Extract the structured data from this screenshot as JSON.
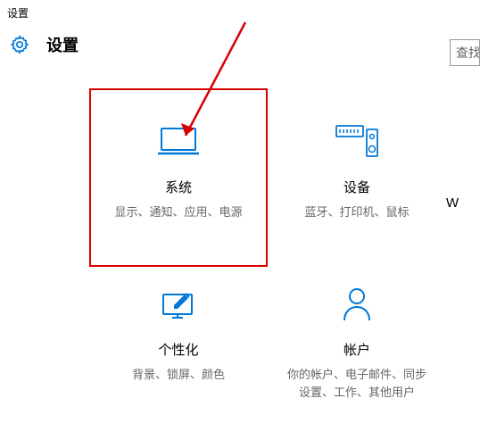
{
  "window": {
    "title": "设置"
  },
  "header": {
    "title": "设置"
  },
  "search": {
    "placeholder": "查找设"
  },
  "tiles": {
    "system": {
      "title": "系统",
      "desc": "显示、通知、应用、电源"
    },
    "devices": {
      "title": "设备",
      "desc": "蓝牙、打印机、鼠标"
    },
    "partial": {
      "title_first_char": "W"
    },
    "personalization": {
      "title": "个性化",
      "desc": "背景、锁屏、颜色"
    },
    "accounts": {
      "title": "帐户",
      "desc": "你的帐户、电子邮件、同步设置、工作、其他用户"
    }
  },
  "colors": {
    "accent": "#0078d7",
    "highlight": "#d80000"
  }
}
